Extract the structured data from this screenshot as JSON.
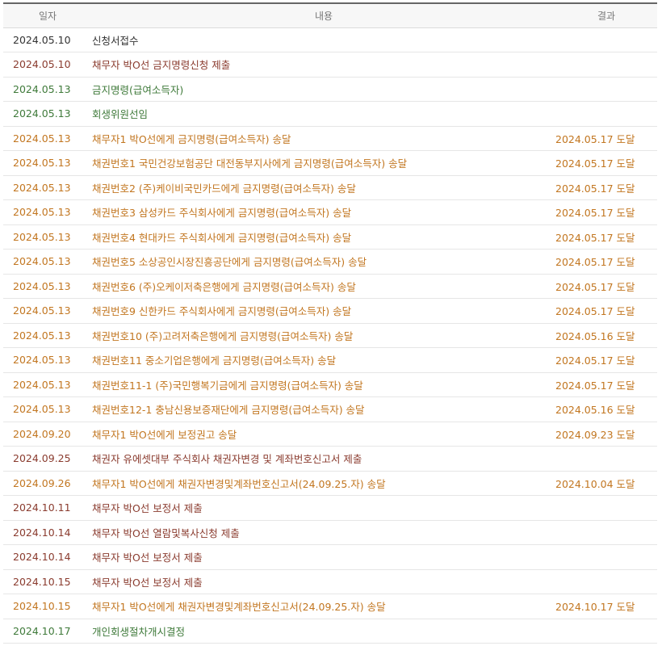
{
  "table": {
    "headers": {
      "date": "일자",
      "content": "내용",
      "result": "결과"
    },
    "colors": {
      "dark": "#333333",
      "brown": "#8a3b2e",
      "green": "#3f7a3a",
      "orange": "#c27620"
    },
    "rows": [
      {
        "date": "2024.05.10",
        "content": "신청서접수",
        "result": "",
        "tone": "dark"
      },
      {
        "date": "2024.05.10",
        "content": "채무자 박O선 금지명령신청 제출",
        "result": "",
        "tone": "brown"
      },
      {
        "date": "2024.05.13",
        "content": "금지명령(급여소득자)",
        "result": "",
        "tone": "green"
      },
      {
        "date": "2024.05.13",
        "content": "회생위원선임",
        "result": "",
        "tone": "green"
      },
      {
        "date": "2024.05.13",
        "content": "채무자1 박O선에게 금지명령(급여소득자) 송달",
        "result": "2024.05.17 도달",
        "tone": "orange"
      },
      {
        "date": "2024.05.13",
        "content": "채권번호1 국민건강보험공단 대전동부지사에게 금지명령(급여소득자) 송달",
        "result": "2024.05.17 도달",
        "tone": "orange"
      },
      {
        "date": "2024.05.13",
        "content": "채권번호2 (주)케이비국민카드에게 금지명령(급여소득자) 송달",
        "result": "2024.05.17 도달",
        "tone": "orange"
      },
      {
        "date": "2024.05.13",
        "content": "채권번호3 삼성카드 주식회사에게 금지명령(급여소득자) 송달",
        "result": "2024.05.17 도달",
        "tone": "orange"
      },
      {
        "date": "2024.05.13",
        "content": "채권번호4 현대카드 주식회사에게 금지명령(급여소득자) 송달",
        "result": "2024.05.17 도달",
        "tone": "orange"
      },
      {
        "date": "2024.05.13",
        "content": "채권번호5 소상공인시장진흥공단에게 금지명령(급여소득자) 송달",
        "result": "2024.05.17 도달",
        "tone": "orange"
      },
      {
        "date": "2024.05.13",
        "content": "채권번호6 (주)오케이저축은행에게 금지명령(급여소득자) 송달",
        "result": "2024.05.17 도달",
        "tone": "orange"
      },
      {
        "date": "2024.05.13",
        "content": "채권번호9 신한카드 주식회사에게 금지명령(급여소득자) 송달",
        "result": "2024.05.17 도달",
        "tone": "orange"
      },
      {
        "date": "2024.05.13",
        "content": "채권번호10 (주)고려저축은행에게 금지명령(급여소득자) 송달",
        "result": "2024.05.16 도달",
        "tone": "orange"
      },
      {
        "date": "2024.05.13",
        "content": "채권번호11 중소기업은행에게 금지명령(급여소득자) 송달",
        "result": "2024.05.17 도달",
        "tone": "orange"
      },
      {
        "date": "2024.05.13",
        "content": "채권번호11-1 (주)국민행복기금에게 금지명령(급여소득자) 송달",
        "result": "2024.05.17 도달",
        "tone": "orange"
      },
      {
        "date": "2024.05.13",
        "content": "채권번호12-1 충남신용보증재단에게 금지명령(급여소득자) 송달",
        "result": "2024.05.16 도달",
        "tone": "orange"
      },
      {
        "date": "2024.09.20",
        "content": "채무자1 박O선에게 보정권고 송달",
        "result": "2024.09.23 도달",
        "tone": "orange"
      },
      {
        "date": "2024.09.25",
        "content": "채권자 유에셋대부 주식회사 채권자변경 및 계좌번호신고서 제출",
        "result": "",
        "tone": "brown"
      },
      {
        "date": "2024.09.26",
        "content": "채무자1 박O선에게 채권자변경및계좌번호신고서(24.09.25.자) 송달",
        "result": "2024.10.04 도달",
        "tone": "orange"
      },
      {
        "date": "2024.10.11",
        "content": "채무자 박O선 보정서 제출",
        "result": "",
        "tone": "brown"
      },
      {
        "date": "2024.10.14",
        "content": "채무자 박O선 열람및복사신청 제출",
        "result": "",
        "tone": "brown"
      },
      {
        "date": "2024.10.14",
        "content": "채무자 박O선 보정서 제출",
        "result": "",
        "tone": "brown"
      },
      {
        "date": "2024.10.15",
        "content": "채무자 박O선 보정서 제출",
        "result": "",
        "tone": "brown"
      },
      {
        "date": "2024.10.15",
        "content": "채무자1 박O선에게 채권자변경및계좌번호신고서(24.09.25.자) 송달",
        "result": "2024.10.17 도달",
        "tone": "orange"
      },
      {
        "date": "2024.10.17",
        "content": "개인회생절차개시결정",
        "result": "",
        "tone": "green"
      }
    ]
  }
}
